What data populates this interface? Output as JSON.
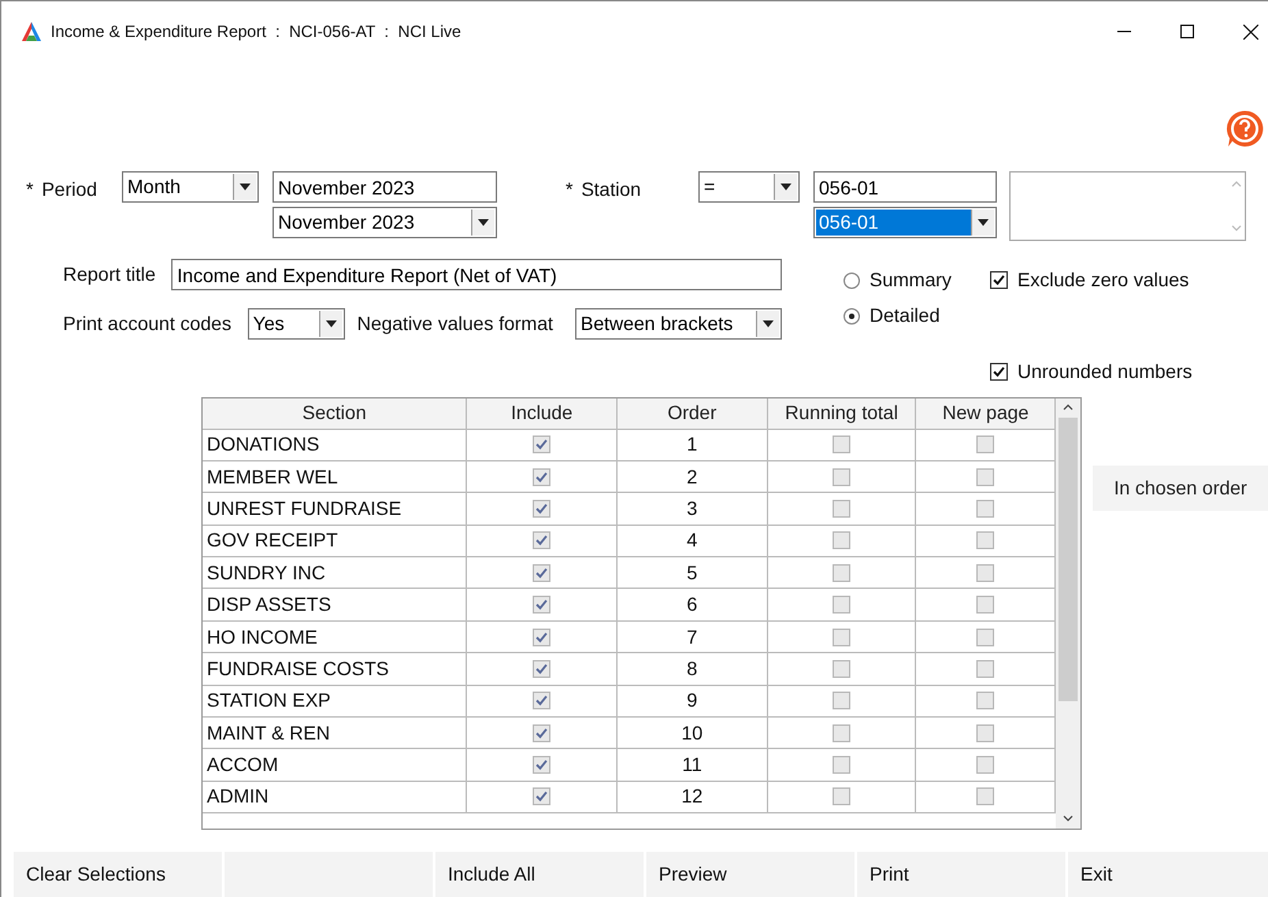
{
  "window": {
    "title": "Income & Expenditure Report  :  NCI-056-AT  :  NCI Live"
  },
  "period": {
    "required_mark": "*",
    "label": "Period",
    "type_value": "Month",
    "from": "November 2023",
    "to": "November 2023"
  },
  "station": {
    "required_mark": "*",
    "label": "Station",
    "operator": "=",
    "value": "056-01",
    "selected_value": "056-01"
  },
  "report_title": {
    "label": "Report title",
    "value": "Income and Expenditure Report (Net of VAT)"
  },
  "print_account_codes": {
    "label": "Print account codes",
    "value": "Yes"
  },
  "negative_values_format": {
    "label": "Negative values format",
    "value": "Between brackets"
  },
  "layout_options": [
    {
      "label": "Summary",
      "selected": false
    },
    {
      "label": "Detailed",
      "selected": true
    }
  ],
  "exclude_zero_values": {
    "label": "Exclude zero values",
    "checked": true
  },
  "unrounded_numbers": {
    "label": "Unrounded numbers",
    "checked": true
  },
  "table": {
    "columns": [
      "Section",
      "Include",
      "Order",
      "Running total",
      "New page"
    ],
    "rows": [
      {
        "section": "DONATIONS",
        "include": true,
        "order": "1",
        "running_total": false,
        "new_page": false
      },
      {
        "section": "MEMBER WEL",
        "include": true,
        "order": "2",
        "running_total": false,
        "new_page": false
      },
      {
        "section": "UNREST FUNDRAISE",
        "include": true,
        "order": "3",
        "running_total": false,
        "new_page": false
      },
      {
        "section": "GOV RECEIPT",
        "include": true,
        "order": "4",
        "running_total": false,
        "new_page": false
      },
      {
        "section": "SUNDRY INC",
        "include": true,
        "order": "5",
        "running_total": false,
        "new_page": false
      },
      {
        "section": "DISP ASSETS",
        "include": true,
        "order": "6",
        "running_total": false,
        "new_page": false
      },
      {
        "section": "HO INCOME",
        "include": true,
        "order": "7",
        "running_total": false,
        "new_page": false
      },
      {
        "section": "FUNDRAISE COSTS",
        "include": true,
        "order": "8",
        "running_total": false,
        "new_page": false
      },
      {
        "section": "STATION EXP",
        "include": true,
        "order": "9",
        "running_total": false,
        "new_page": false
      },
      {
        "section": "MAINT & REN",
        "include": true,
        "order": "10",
        "running_total": false,
        "new_page": false
      },
      {
        "section": "ACCOM",
        "include": true,
        "order": "11",
        "running_total": false,
        "new_page": false
      },
      {
        "section": "ADMIN",
        "include": true,
        "order": "12",
        "running_total": false,
        "new_page": false
      }
    ]
  },
  "order_button": "In chosen order",
  "buttons": [
    {
      "kind": "button",
      "label": "Clear Selections"
    },
    {
      "kind": "blank"
    },
    {
      "kind": "button",
      "label": "Include All"
    },
    {
      "kind": "button",
      "label": "Preview"
    },
    {
      "kind": "button",
      "label": "Print"
    },
    {
      "kind": "button",
      "label": "Exit"
    }
  ]
}
